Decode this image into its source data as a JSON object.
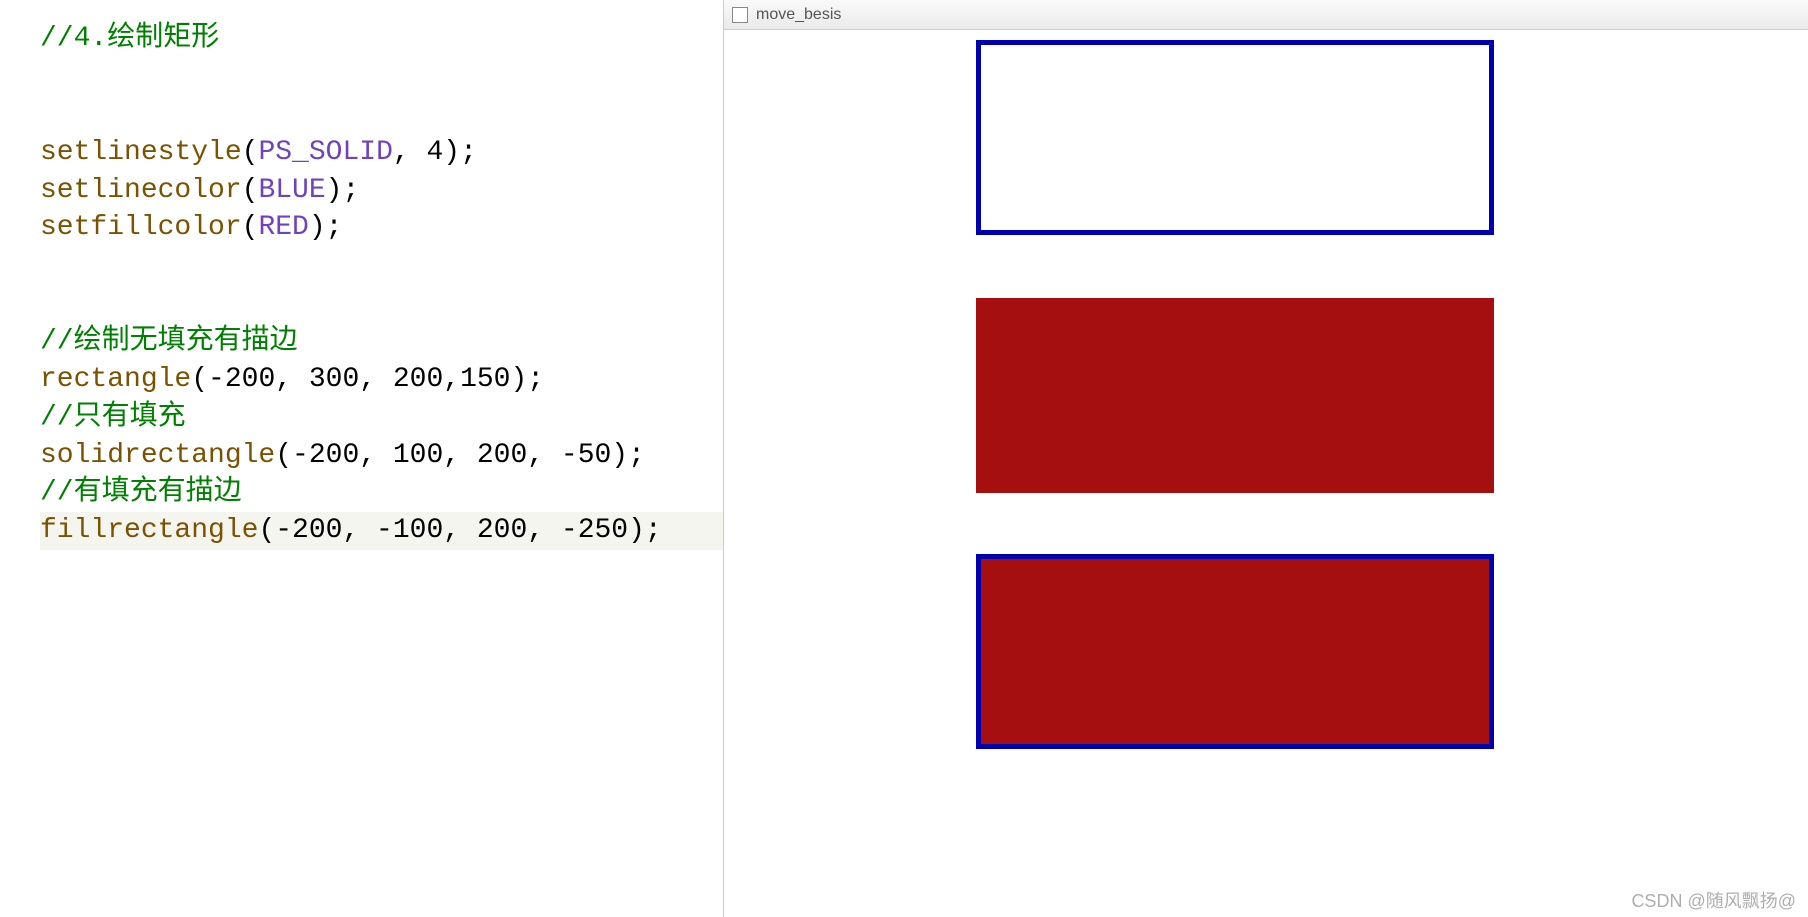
{
  "code": {
    "comment_header": "//4.绘制矩形",
    "line_setlinestyle_func": "setlinestyle",
    "line_setlinestyle_arg1": "PS_SOLID",
    "line_setlinestyle_arg2": "4",
    "line_setlinecolor_func": "setlinecolor",
    "line_setlinecolor_arg": "BLUE",
    "line_setfillcolor_func": "setfillcolor",
    "line_setfillcolor_arg": "RED",
    "comment_rect": "//绘制无填充有描边",
    "rectangle_func": "rectangle",
    "rectangle_args": "(-200, 300, 200,150);",
    "comment_solid": "//只有填充",
    "solidrectangle_func": "solidrectangle",
    "solidrectangle_args": "(-200, 100, 200, -50);",
    "comment_fill": "//有填充有描边",
    "fillrectangle_func": "fillrectangle",
    "fillrectangle_args": "(-200, -100, 200, -250);"
  },
  "output": {
    "window_title": "move_besis"
  },
  "watermark": "CSDN @随风飘扬@"
}
